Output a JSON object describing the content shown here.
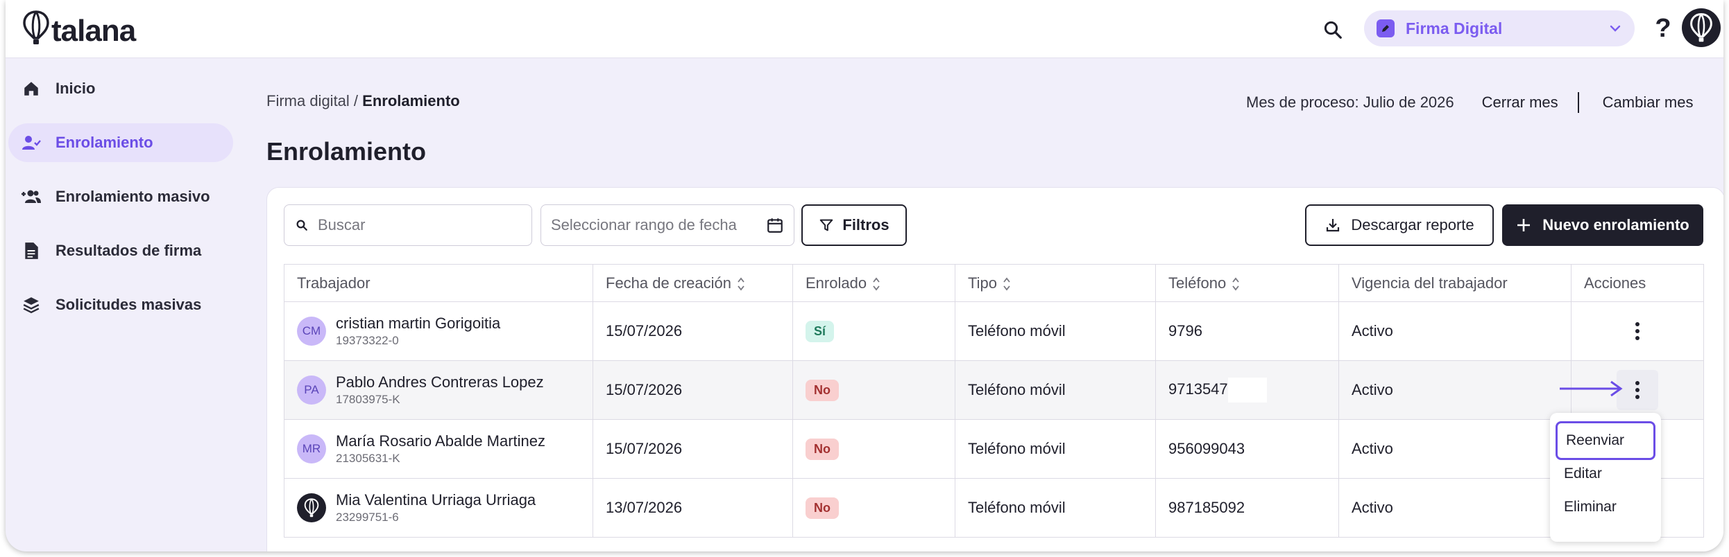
{
  "app": {
    "logo_text": "talana"
  },
  "header": {
    "module_label": "Firma Digital",
    "help_label": "?"
  },
  "sidebar": {
    "items": [
      {
        "label": "Inicio",
        "icon": "home-icon"
      },
      {
        "label": "Enrolamiento",
        "icon": "user-check-icon",
        "active": true
      },
      {
        "label": "Enrolamiento masivo",
        "icon": "users-add-icon"
      },
      {
        "label": "Resultados de firma",
        "icon": "document-icon"
      },
      {
        "label": "Solicitudes masivas",
        "icon": "layers-icon"
      }
    ]
  },
  "breadcrumb": {
    "parent": "Firma digital",
    "separator": " / ",
    "current": "Enrolamiento"
  },
  "process": {
    "month_text": "Mes de proceso: Julio de 2026",
    "close_label": "Cerrar mes",
    "change_label": "Cambiar mes"
  },
  "page_title": "Enrolamiento",
  "toolbar": {
    "search_placeholder": "Buscar",
    "date_placeholder": "Seleccionar rango de fecha",
    "filters_label": "Filtros",
    "download_label": "Descargar reporte",
    "new_label": "Nuevo enrolamiento"
  },
  "table": {
    "columns": [
      "Trabajador",
      "Fecha de creación",
      "Enrolado",
      "Tipo",
      "Teléfono",
      "Vigencia del trabajador",
      "Acciones"
    ],
    "rows": [
      {
        "initials": "CM",
        "name": "cristian martin Gorigoitia",
        "rut": "19373322-0",
        "date": "15/07/2026",
        "enrolled": "Sí",
        "type": "Teléfono móvil",
        "phone": "9796",
        "status": "Activo"
      },
      {
        "initials": "PA",
        "name": "Pablo Andres Contreras Lopez",
        "rut": "17803975-K",
        "date": "15/07/2026",
        "enrolled": "No",
        "type": "Teléfono móvil",
        "phone": "9713547",
        "status": "Activo"
      },
      {
        "initials": "MR",
        "name": "María Rosario Abalde Martinez",
        "rut": "21305631-K",
        "date": "15/07/2026",
        "enrolled": "No",
        "type": "Teléfono móvil",
        "phone": "956099043",
        "status": "Activo"
      },
      {
        "initials": "",
        "name": "Mia Valentina Urriaga Urriaga",
        "rut": "23299751-6",
        "date": "13/07/2026",
        "enrolled": "No",
        "type": "Teléfono móvil",
        "phone": "987185092",
        "status": "Activo"
      }
    ]
  },
  "actions_menu": {
    "items": [
      "Reenviar",
      "Editar",
      "Eliminar"
    ]
  },
  "colors": {
    "accent": "#6b4de6",
    "dark": "#1f1f2b",
    "background": "#f1effa",
    "badge_yes": "#d4f4ec",
    "badge_no": "#f9cfcf"
  }
}
